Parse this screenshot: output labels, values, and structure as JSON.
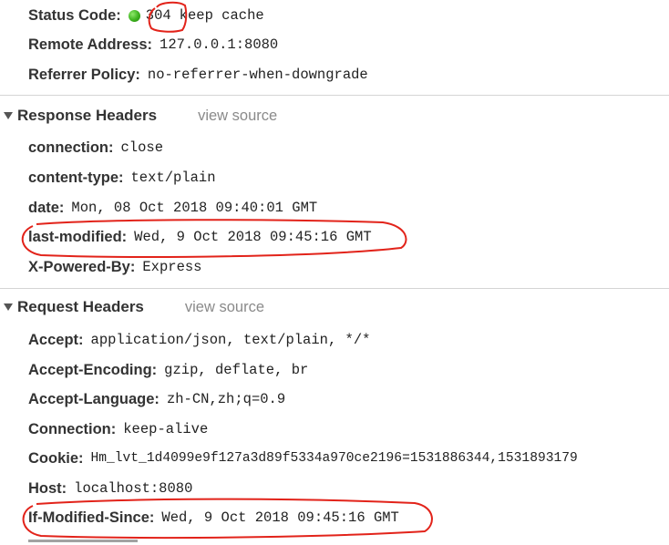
{
  "general": {
    "status_code": {
      "key": "Status Code:",
      "code": "304",
      "text": "keep cache",
      "status_color": "#3cb21d"
    },
    "remote_address": {
      "key": "Remote Address:",
      "value": "127.0.0.1:8080"
    },
    "referrer_policy": {
      "key": "Referrer Policy:",
      "value": "no-referrer-when-downgrade"
    }
  },
  "response_headers": {
    "title": "Response Headers",
    "view_source": "view source",
    "items": [
      {
        "key": "connection:",
        "value": "close"
      },
      {
        "key": "content-type:",
        "value": "text/plain"
      },
      {
        "key": "date:",
        "value": "Mon, 08 Oct 2018 09:40:01 GMT"
      },
      {
        "key": "last-modified:",
        "value": "Wed, 9 Oct 2018 09:45:16 GMT"
      },
      {
        "key": "X-Powered-By:",
        "value": "Express"
      }
    ]
  },
  "request_headers": {
    "title": "Request Headers",
    "view_source": "view source",
    "items": [
      {
        "key": "Accept:",
        "value": "application/json, text/plain, */*"
      },
      {
        "key": "Accept-Encoding:",
        "value": "gzip, deflate, br"
      },
      {
        "key": "Accept-Language:",
        "value": "zh-CN,zh;q=0.9"
      },
      {
        "key": "Connection:",
        "value": "keep-alive"
      },
      {
        "key": "Cookie:",
        "value": "Hm_lvt_1d4099e9f127a3d89f5334a970ce2196=1531886344,1531893179"
      },
      {
        "key": "Host:",
        "value": "localhost:8080"
      },
      {
        "key": "If-Modified-Since:",
        "value": "Wed, 9 Oct 2018 09:45:16 GMT"
      }
    ]
  },
  "annotation_color": "#e2231a"
}
